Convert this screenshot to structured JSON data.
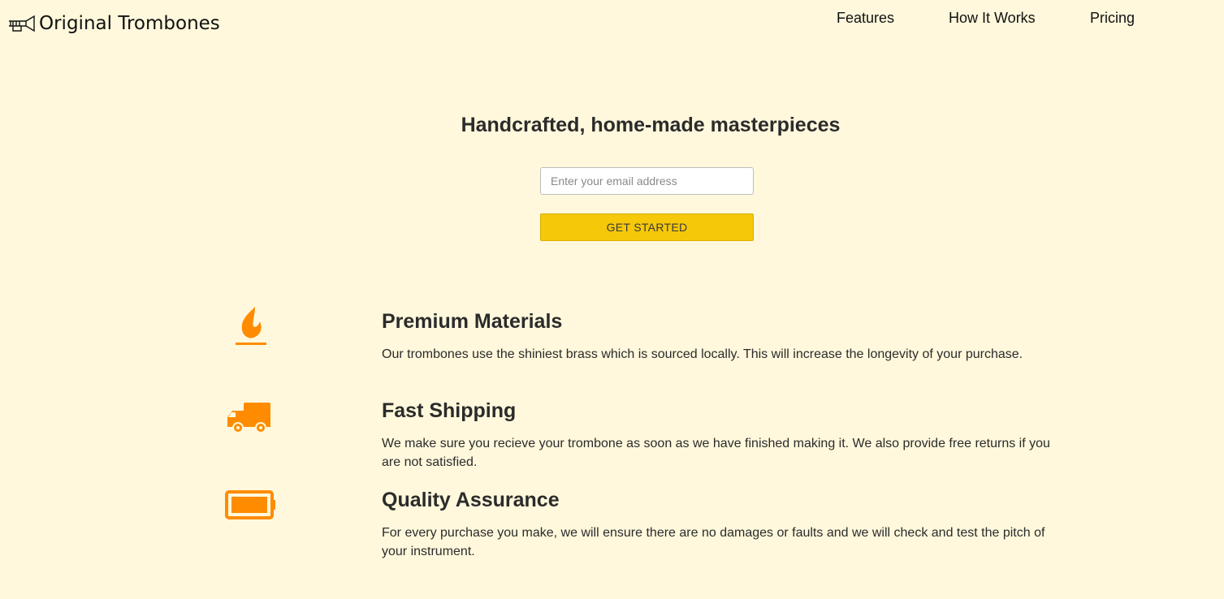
{
  "header": {
    "brand_name": "Original Trombones",
    "logo_icon": "trombone-icon",
    "nav": [
      {
        "label": "Features"
      },
      {
        "label": "How It Works"
      },
      {
        "label": "Pricing"
      }
    ]
  },
  "hero": {
    "title": "Handcrafted, home-made masterpieces",
    "email_placeholder": "Enter your email address",
    "cta_label": "GET STARTED"
  },
  "features": [
    {
      "icon": "fire-icon",
      "title": "Premium Materials",
      "description": "Our trombones use the shiniest brass which is sourced locally. This will increase the longevity of your purchase."
    },
    {
      "icon": "truck-icon",
      "title": "Fast Shipping",
      "description": "We make sure you recieve your trombone as soon as we have finished making it. We also provide free returns if you are not satisfied."
    },
    {
      "icon": "battery-full-icon",
      "title": "Quality Assurance",
      "description": "For every purchase you make, we will ensure there are no damages or faults and we will check and test the pitch of your instrument."
    }
  ],
  "colors": {
    "background": "#fff8dc",
    "accent_button": "#f5c80a",
    "icon_orange": "#ff8c00"
  }
}
